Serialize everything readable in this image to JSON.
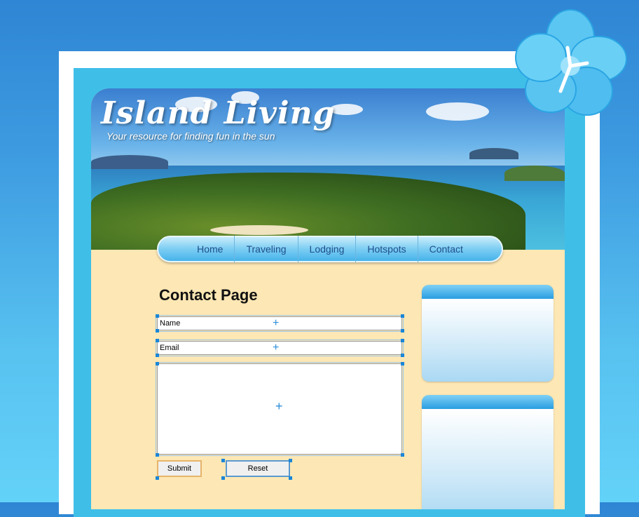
{
  "header": {
    "logo_title": "Island Living",
    "logo_tagline": "Your resource for finding fun in the sun"
  },
  "nav": {
    "items": [
      {
        "label": "Home"
      },
      {
        "label": "Traveling"
      },
      {
        "label": "Lodging"
      },
      {
        "label": "Hotspots"
      },
      {
        "label": "Contact"
      }
    ]
  },
  "main": {
    "title": "Contact Page",
    "form": {
      "name_field": "Name",
      "email_field": "Email",
      "message_field": "",
      "submit_label": "Submit",
      "reset_label": "Reset"
    }
  },
  "colors": {
    "background": "#3d9ae0",
    "frame_cyan": "#3fbfe8",
    "page_cream": "#fde7b4",
    "nav_text": "#1f4e8a",
    "selection_handle": "#1a86d8"
  },
  "icons": {
    "decoration": "hibiscus-flower-icon",
    "field_marker": "crosshair-icon"
  }
}
